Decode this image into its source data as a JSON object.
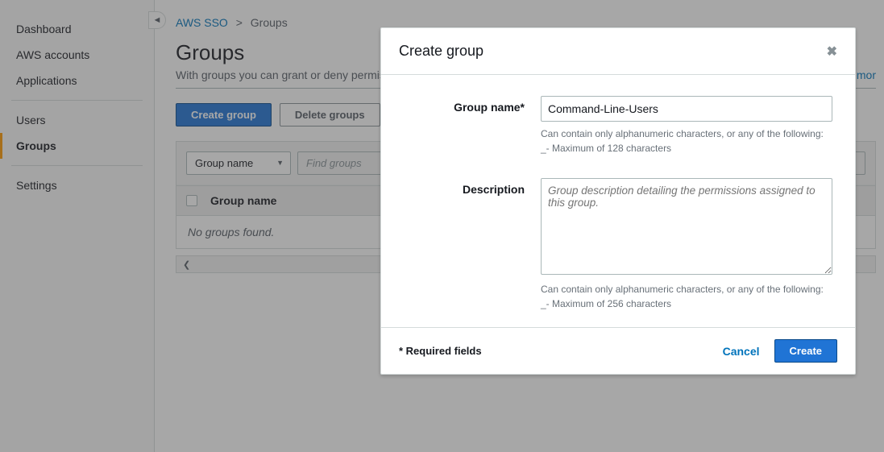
{
  "sidebar": {
    "items": [
      {
        "label": "Dashboard"
      },
      {
        "label": "AWS accounts"
      },
      {
        "label": "Applications"
      },
      {
        "label": "Users"
      },
      {
        "label": "Groups",
        "selected": true
      },
      {
        "label": "Settings"
      }
    ]
  },
  "breadcrumb": {
    "root": "AWS SSO",
    "sep": ">",
    "current": "Groups"
  },
  "page": {
    "title": "Groups",
    "subtitle": "With groups you can grant or deny permis",
    "more_link": "mor"
  },
  "actions": {
    "create_label": "Create group",
    "delete_label": "Delete groups"
  },
  "filter": {
    "by_label": "Group name",
    "search_placeholder": "Find groups"
  },
  "table": {
    "col_name": "Group name",
    "empty": "No groups found."
  },
  "modal": {
    "title": "Create group",
    "group_name_label": "Group name*",
    "group_name_value": "Command-Line-Users",
    "group_name_hint": "Can contain only alphanumeric characters, or any of the following: _- Maximum of 128 characters",
    "description_label": "Description",
    "description_placeholder": "Group description detailing the permissions assigned to this group.",
    "description_hint": "Can contain only alphanumeric characters, or any of the following: _- Maximum of 256 characters",
    "required_note": "*   Required fields",
    "cancel_label": "Cancel",
    "create_label": "Create"
  }
}
